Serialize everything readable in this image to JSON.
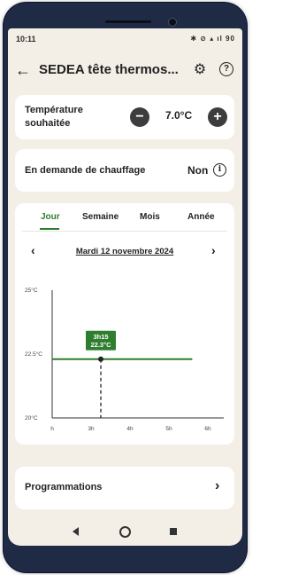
{
  "status_bar": {
    "time": "10:11",
    "icons_text": "✱ ⊘ ▴ ıl 90"
  },
  "header": {
    "title": "SEDEA tête thermos...",
    "back_icon": "arrow-left-icon",
    "settings_icon": "gear-icon",
    "help_icon": "question-circle-icon",
    "help_glyph": "?"
  },
  "temperature": {
    "label_line1": "Température",
    "label_line2": "souhaitée",
    "minus": "−",
    "value": "7.0°C",
    "plus": "+"
  },
  "heating_demand": {
    "label": "En demande de chauffage",
    "value": "Non",
    "info_glyph": "i"
  },
  "tabs": [
    {
      "label": "Jour",
      "active": true
    },
    {
      "label": "Semaine",
      "active": false
    },
    {
      "label": "Mois",
      "active": false
    },
    {
      "label": "Année",
      "active": false
    }
  ],
  "date_nav": {
    "prev": "‹",
    "date": "Mardi 12 novembre 2024",
    "next": "›"
  },
  "chart_data": {
    "type": "line",
    "y_ticks": [
      "25°C",
      "22.5°C",
      "20°C"
    ],
    "x_ticks": [
      "h",
      "3h",
      "4h",
      "5h",
      "6h"
    ],
    "ylim": [
      20,
      25
    ],
    "series": [
      {
        "values_x_hours": [
          2,
          5.6
        ],
        "values_y": [
          22.3,
          22.3
        ]
      }
    ],
    "tooltip": {
      "time": "3h15",
      "value": "22.3°C",
      "x_hours": 3.25,
      "y": 22.3
    },
    "colors": {
      "line": "#2f7d2e",
      "tooltip_bg": "#2f7d2e",
      "axis": "#333333"
    }
  },
  "programmations": {
    "label": "Programmations",
    "chevron": "›"
  }
}
